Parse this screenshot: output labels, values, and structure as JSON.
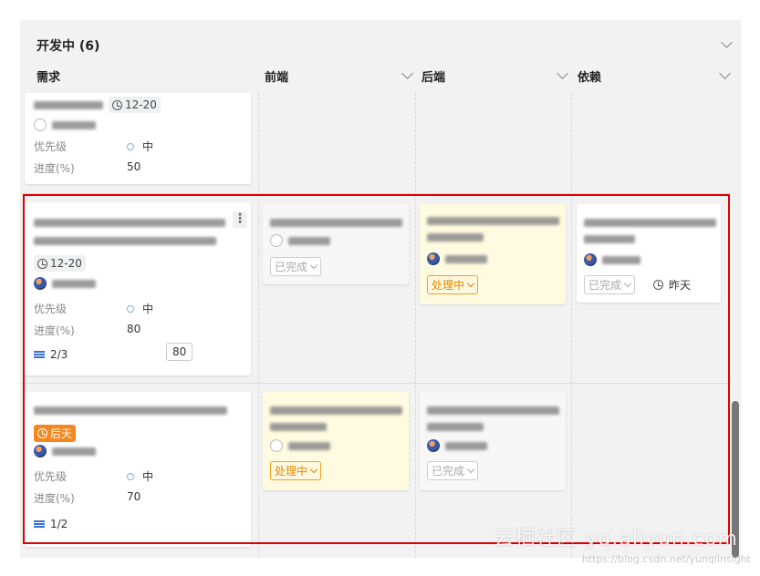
{
  "group": {
    "title": "开发中 (6)"
  },
  "columns": {
    "req": "需求",
    "front": "前端",
    "back": "后端",
    "dep": "依赖"
  },
  "card0": {
    "date": "12-20",
    "prio_label": "优先级",
    "prio": "中",
    "prog_label": "进度(%)",
    "prog": "50"
  },
  "card1": {
    "date": "12-20",
    "prio_label": "优先级",
    "prio": "中",
    "prog_label": "进度(%)",
    "prog": "80",
    "sub": "2/3",
    "badge": "80"
  },
  "card1_front": {
    "status": "已完成"
  },
  "card1_back": {
    "status": "处理中"
  },
  "card1_dep": {
    "status": "已完成",
    "time": "昨天"
  },
  "card2": {
    "late": "后天",
    "prio_label": "优先级",
    "prio": "中",
    "prog_label": "进度(%)",
    "prog": "70",
    "sub": "1/2"
  },
  "card2_front": {
    "status": "处理中"
  },
  "card2_back": {
    "status": "已完成"
  },
  "watermark": {
    "main": "云栖社区 yq.aliyun.com",
    "url": "https://blog.csdn.net/yunqiinsight"
  }
}
